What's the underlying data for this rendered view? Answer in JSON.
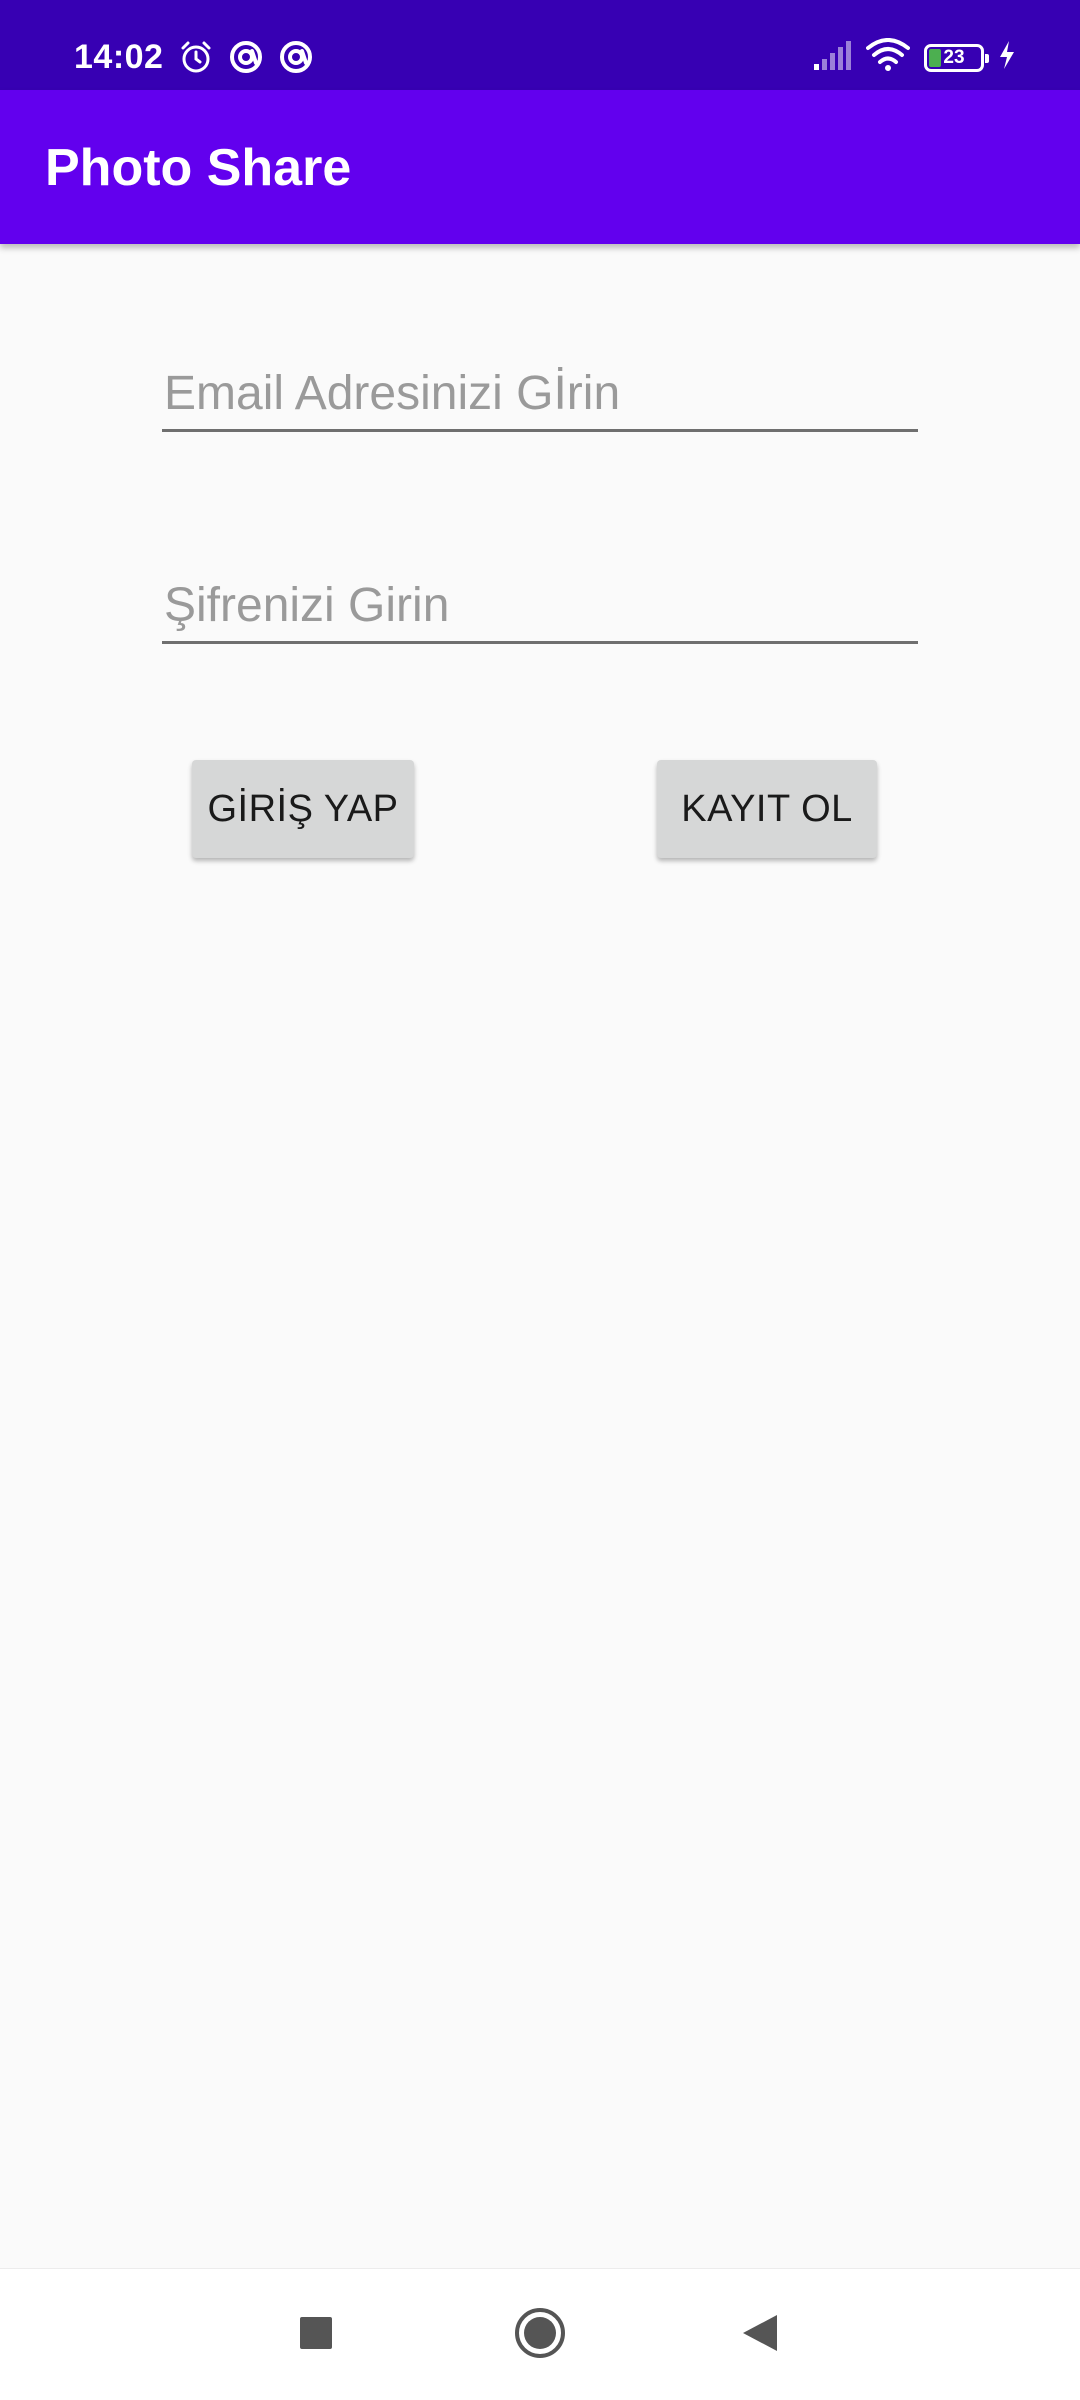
{
  "status_bar": {
    "time": "14:02",
    "left_icons": [
      "alarm-icon",
      "at-sign-icon",
      "at-sign-icon"
    ],
    "right_icons": [
      "signal-icon",
      "wifi-icon",
      "battery-icon",
      "charging-icon"
    ],
    "battery_level": "23",
    "background": "#3700b3"
  },
  "app_bar": {
    "title": "Photo Share",
    "background": "#6200ee"
  },
  "form": {
    "email_placeholder": "Email Adresinizi Gİrin",
    "email_value": "",
    "password_placeholder": "Şifrenizi Girin",
    "password_value": ""
  },
  "buttons": {
    "login_label": "GİRİŞ YAP",
    "register_label": "KAYIT OL"
  },
  "nav_bar": {
    "icons": [
      "recents-square-icon",
      "home-circle-icon",
      "back-triangle-icon"
    ]
  }
}
